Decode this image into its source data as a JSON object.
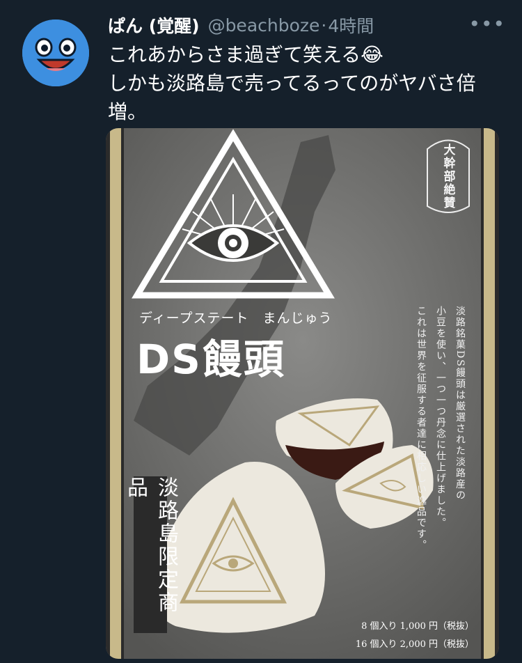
{
  "tweet": {
    "display_name": "ぱん (覚醒)",
    "handle": "@beachboze",
    "separator": "·",
    "time": "4時間",
    "more_icon": "more-dots-icon",
    "text_line1": "これあからさま過ぎて笑える😂",
    "text_line2": "しかも淡路島で売ってるってのがヤバさ倍",
    "text_line3": "増。",
    "avatar_icon": "slime-face-avatar"
  },
  "media": {
    "badge": "大幹部絶賛",
    "subtitle": "ディープステート　まんじゅう",
    "product_name": "DS饅頭",
    "description_col1": "淡路銘菓DS饅頭は厳選された淡路産の",
    "description_col2": "小豆を使い、一つ一つ丹念に仕上げました。",
    "description_col3": "これは世界を征服する者達に相応しい逸品です。",
    "limited_label": "淡路島限定商品",
    "price_8": "8 個入り 1,000 円（税抜）",
    "price_16": "16 個入り 2,000 円（税抜）",
    "colors": {
      "background": "#15202b",
      "poster_gray": "#6e6e6c",
      "gold_border": "#c8b98a",
      "manju_white": "#ece8de",
      "eye_gold": "#b9a77a"
    }
  }
}
